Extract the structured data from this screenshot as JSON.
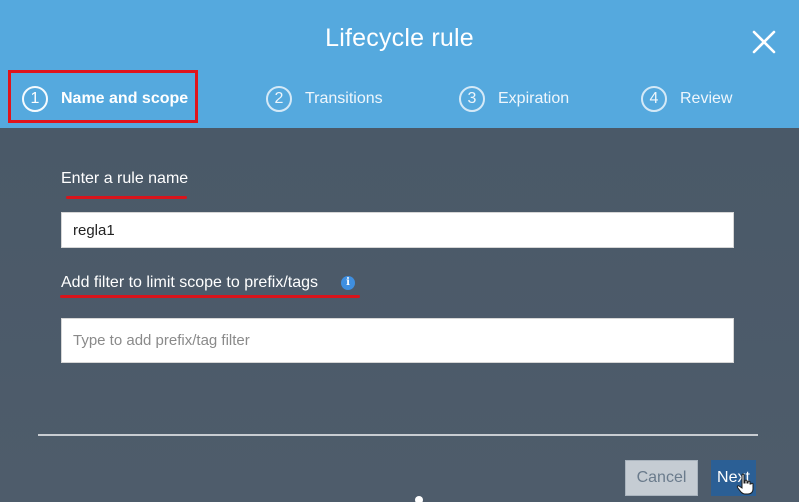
{
  "dialog": {
    "title": "Lifecycle rule"
  },
  "steps": [
    {
      "number": "1",
      "label": "Name and scope"
    },
    {
      "number": "2",
      "label": "Transitions"
    },
    {
      "number": "3",
      "label": "Expiration"
    },
    {
      "number": "4",
      "label": "Review"
    }
  ],
  "form": {
    "rule_name_label": "Enter a rule name",
    "rule_name_value": "regla1",
    "filter_label": "Add filter to limit scope to prefix/tags",
    "filter_placeholder": "Type to add prefix/tag filter",
    "info_glyph": "i"
  },
  "footer": {
    "cancel_label": "Cancel",
    "next_label": "Next"
  },
  "colors": {
    "header": "#55a9de",
    "body": "#4a5968",
    "highlight": "#e0141b",
    "primary_button": "#2b5f95"
  }
}
